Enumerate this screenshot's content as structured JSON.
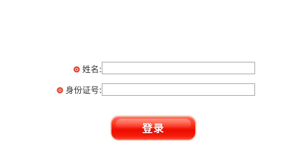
{
  "form": {
    "name_label": "姓名:",
    "id_label": "身份证号:",
    "name_value": "",
    "id_value": "",
    "required_icon": "red-dot-bullet-icon"
  },
  "actions": {
    "login_label": "登录"
  },
  "colors": {
    "required_icon": "#e0442f",
    "button_red": "#ee0b00",
    "field_border": "#a9a9a9"
  }
}
